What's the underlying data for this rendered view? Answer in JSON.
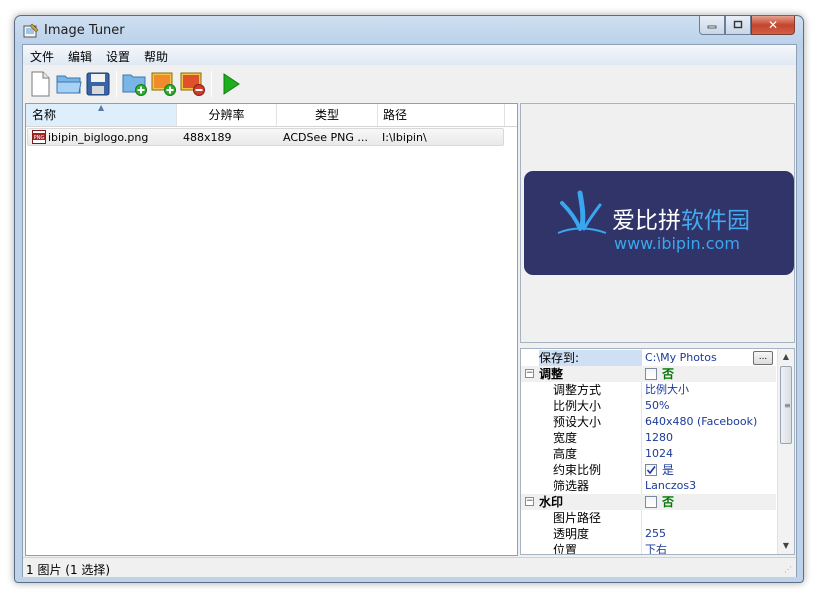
{
  "window": {
    "title": "Image Tuner"
  },
  "menu": [
    "文件",
    "编辑",
    "设置",
    "帮助"
  ],
  "toolbar": {
    "buttons": [
      "new-file-icon",
      "open-folder-icon",
      "save-icon",
      "add-folder-icon",
      "add-image-icon",
      "remove-image-icon",
      "run-icon"
    ],
    "accent_green": "#1bb01b"
  },
  "list": {
    "columns": [
      "名称",
      "分辨率",
      "类型",
      "路径"
    ],
    "rows": [
      {
        "name": "ibipin_biglogo.png",
        "resolution": "488x189",
        "type": "ACDSee PNG ...",
        "path": "I:\\Ibipin\\"
      }
    ]
  },
  "preview": {
    "logo_cn_a": "爱比拼",
    "logo_cn_b": "软件园",
    "logo_en": "www.ibipin.com",
    "bg_color": "#303469"
  },
  "properties": {
    "save_to_label": "保存到:",
    "save_to_value": "C:\\My Photos",
    "browse_label": "...",
    "adjust": {
      "label": "调整",
      "checkbox_label": "否"
    },
    "adjust_mode": {
      "label": "调整方式",
      "value": "比例大小"
    },
    "scale": {
      "label": "比例大小",
      "value": "50%"
    },
    "preset": {
      "label": "预设大小",
      "value": "640x480 (Facebook)"
    },
    "width": {
      "label": "宽度",
      "value": "1280"
    },
    "height": {
      "label": "高度",
      "value": "1024"
    },
    "keep_ratio": {
      "label": "约束比例",
      "checkbox_label": "是"
    },
    "filter": {
      "label": "筛选器",
      "value": "Lanczos3"
    },
    "watermark": {
      "label": "水印",
      "checkbox_label": "否"
    },
    "image_path": {
      "label": "图片路径",
      "value": ""
    },
    "opacity": {
      "label": "透明度",
      "value": "255"
    },
    "position": {
      "label": "位置",
      "value": "下右"
    }
  },
  "status": {
    "text": "1 图片 (1 选择)"
  }
}
